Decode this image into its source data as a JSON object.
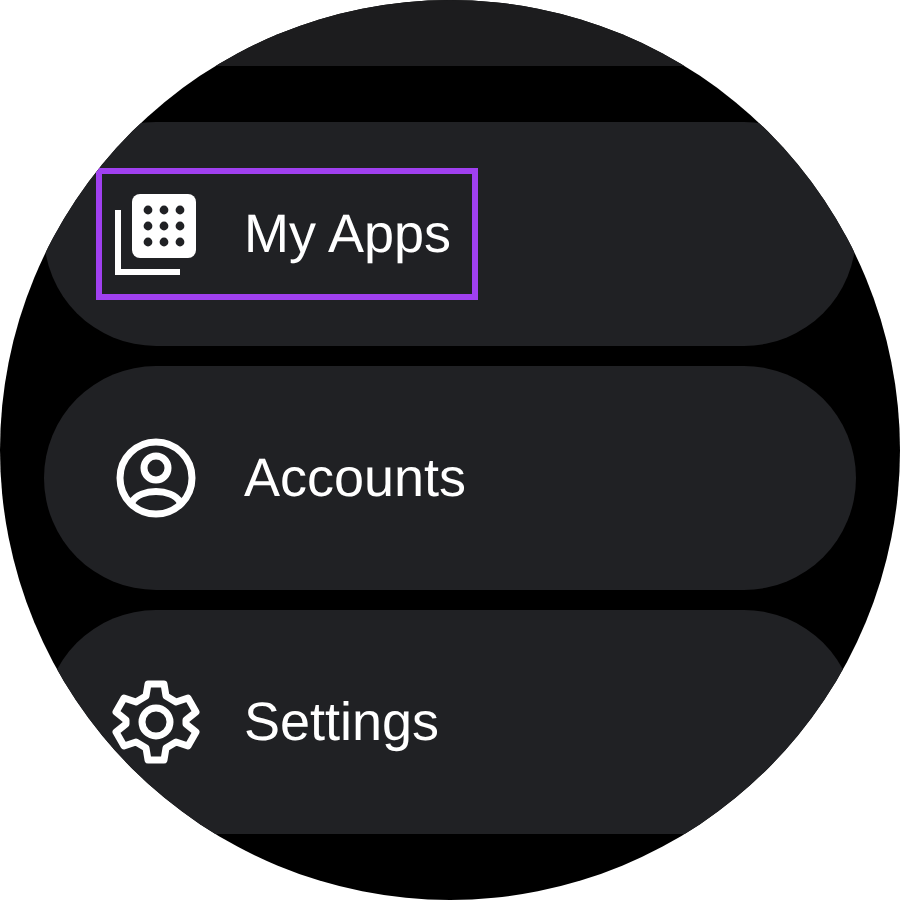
{
  "menu": [
    {
      "kind": "apps",
      "label": "My Apps",
      "highlighted": true
    },
    {
      "kind": "account",
      "label": "Accounts",
      "highlighted": false
    },
    {
      "kind": "settings",
      "label": "Settings",
      "highlighted": false
    }
  ]
}
